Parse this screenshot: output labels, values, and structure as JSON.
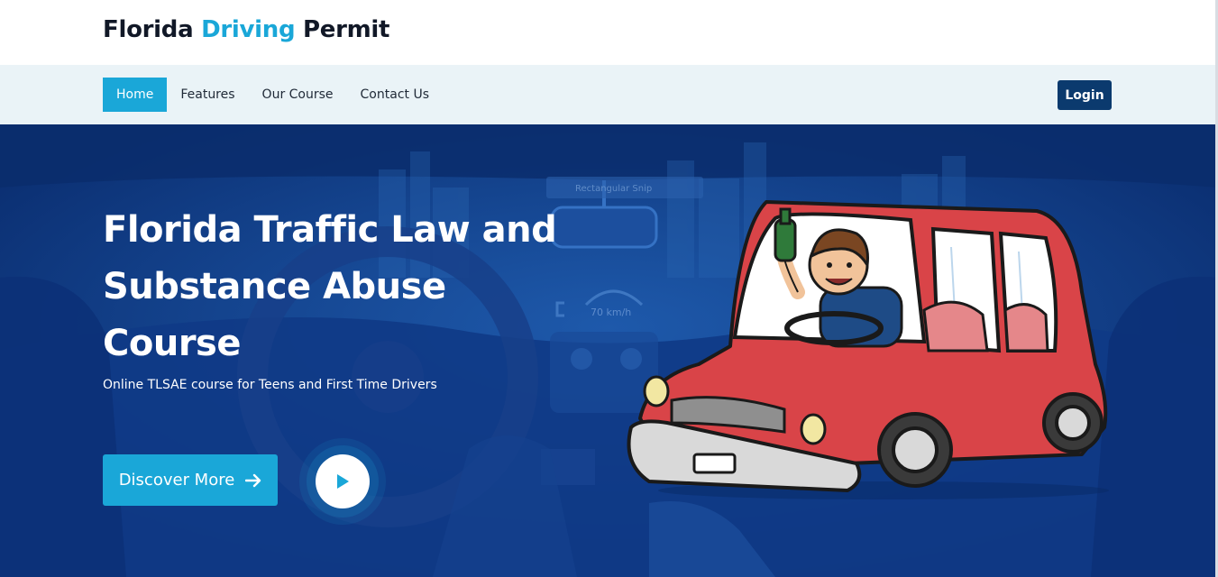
{
  "header": {
    "brand_part1": "Florida ",
    "brand_accent": "Driving",
    "brand_part2": " Permit"
  },
  "nav": {
    "items": [
      {
        "label": "Home",
        "active": true
      },
      {
        "label": "Features",
        "active": false
      },
      {
        "label": "Our Course",
        "active": false
      },
      {
        "label": "Contact Us",
        "active": false
      }
    ],
    "login_label": "Login"
  },
  "hero": {
    "title": "Florida Traffic Law and Substance Abuse Course",
    "subtitle": "Online TLSAE course for Teens and First Time Drivers",
    "discover_label": "Discover More",
    "background_hud_text": "70 km/h",
    "background_sign_text": "Rectangular Snip"
  },
  "icons": {
    "discover_arrow": "arrow-right-icon",
    "play": "play-icon"
  },
  "colors": {
    "accent": "#1aa7d8",
    "nav_bg": "#eaf3f7",
    "login_bg": "#0b3a6e",
    "hero_bg": "#0d3a86",
    "car_red": "#d94448"
  }
}
